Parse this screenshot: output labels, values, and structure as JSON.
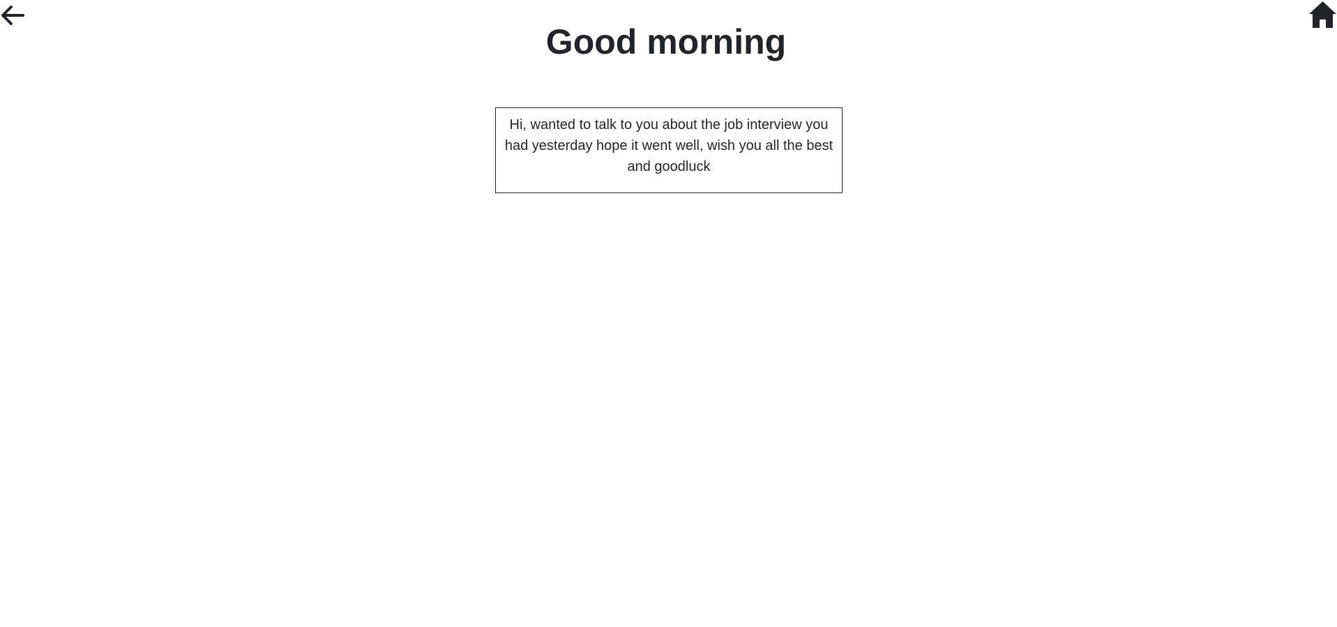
{
  "header": {
    "back_icon": "arrow-left-icon",
    "home_icon": "house-icon",
    "title": "Good morning"
  },
  "message": {
    "text": "Hi, wanted to talk to you about the job interview you had yesterday hope it went well, wish you all the best and goodluck"
  },
  "colors": {
    "text": "#212529",
    "background": "#ffffff",
    "border": "#212529"
  }
}
